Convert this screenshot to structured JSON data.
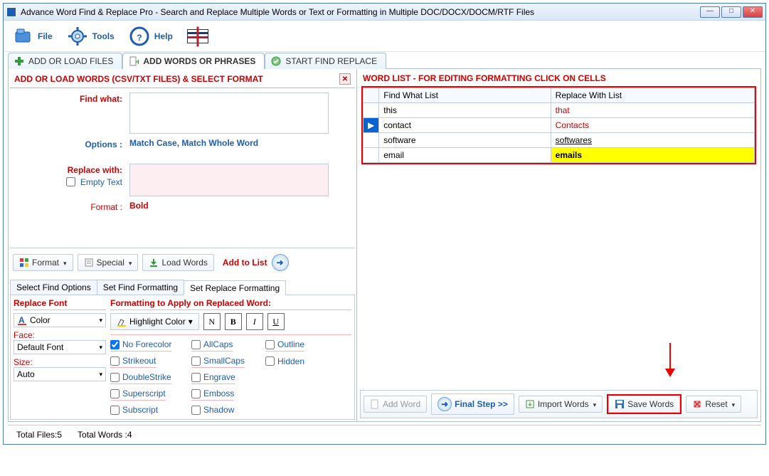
{
  "titlebar": {
    "title": "Advance Word Find & Replace Pro - Search and Replace Multiple Words or Text  or Formatting in Multiple DOC/DOCX/DOCM/RTF Files"
  },
  "menu": {
    "file": "File",
    "tools": "Tools",
    "help": "Help"
  },
  "tabs": {
    "t1": "ADD OR LOAD FILES",
    "t2": "ADD WORDS OR PHRASES",
    "t3": "START FIND REPLACE"
  },
  "leftpanel": {
    "heading": "ADD OR LOAD WORDS (CSV/TXT FILES) & SELECT FORMAT",
    "find_label": "Find what:",
    "options_label": "Options :",
    "options_value": "Match Case, Match Whole Word",
    "replace_label": "Replace with:",
    "empty_text": "Empty Text",
    "format_label": "Format :",
    "format_value": "Bold",
    "btn_format": "Format",
    "btn_special": "Special",
    "btn_load": "Load Words",
    "btn_addlist": "Add to List"
  },
  "subtabs": {
    "s1": "Select Find Options",
    "s2": "Set Find Formatting",
    "s3": "Set Replace Formatting"
  },
  "fmt": {
    "col1_head": "Replace Font",
    "color_btn": "Color",
    "face_label": "Face:",
    "face_value": "Default Font",
    "size_label": "Size:",
    "size_value": "Auto",
    "col2_head": "Formatting to Apply on Replaced Word:",
    "highlight_btn": "Highlight Color",
    "n": "N",
    "b": "B",
    "i": "I",
    "u": "U",
    "noforecolor": "No Forecolor",
    "allcaps": "AllCaps",
    "outline": "Outline",
    "strikeout": "Strikeout",
    "smallcaps": "SmallCaps",
    "hidden": "Hidden",
    "doublestrike": "DoubleStrike",
    "engrave": "Engrave",
    "superscript": "Superscript",
    "emboss": "Emboss",
    "subscript": "Subscript",
    "shadow": "Shadow"
  },
  "rightpanel": {
    "heading": "WORD LIST - FOR EDITING FORMATTING CLICK ON CELLS",
    "col_find": "Find What List",
    "col_replace": "Replace With List",
    "rows": [
      {
        "find": "this",
        "replace": "that",
        "style": "red"
      },
      {
        "find": "contact",
        "replace": "Contacts",
        "style": "sel"
      },
      {
        "find": "software",
        "replace": "softwares",
        "style": "underline"
      },
      {
        "find": "email",
        "replace": "emails",
        "style": "hl"
      }
    ],
    "btn_addword": "Add Word",
    "btn_finalstep": "Final Step >>",
    "btn_import": "Import Words",
    "btn_save": "Save Words",
    "btn_reset": "Reset"
  },
  "status": {
    "files": "Total Files:5",
    "words": "Total Words :4"
  }
}
